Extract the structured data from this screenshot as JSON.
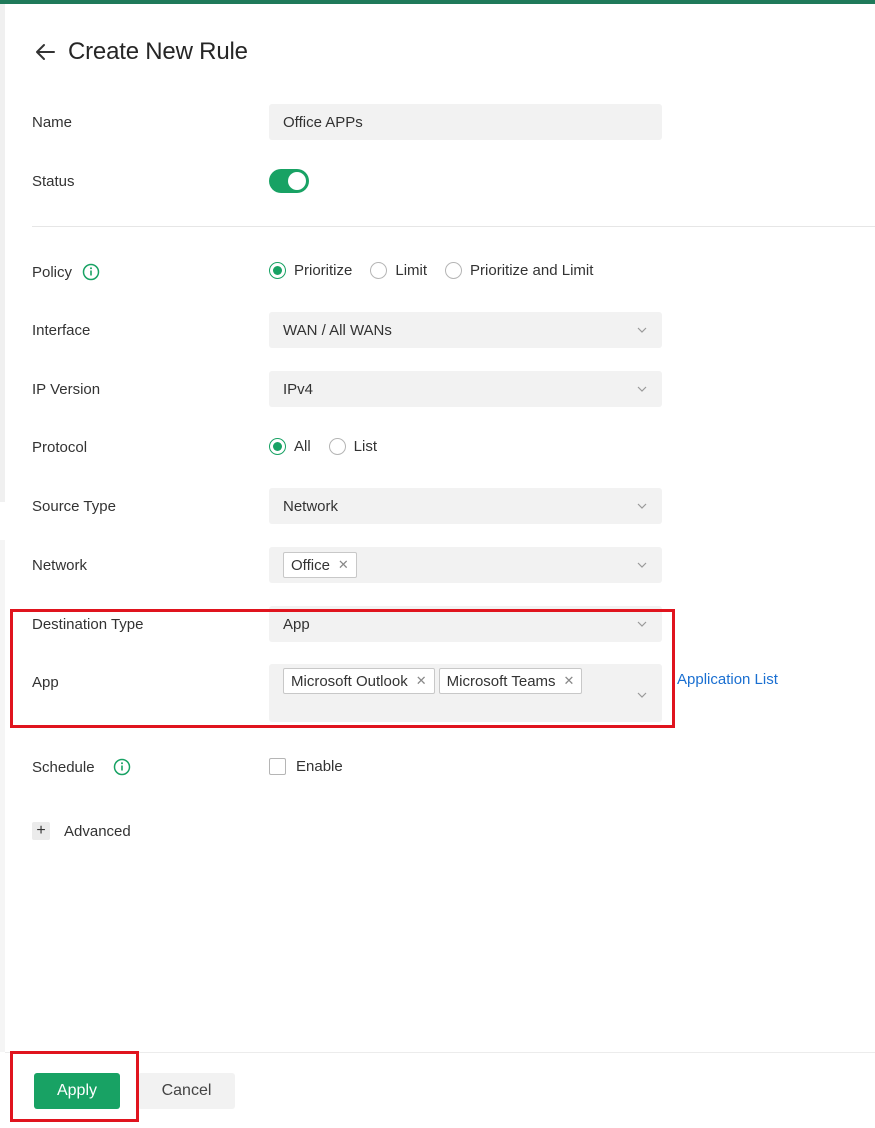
{
  "header": {
    "title": "Create New Rule",
    "back_icon": "arrow-left-icon"
  },
  "form": {
    "name": {
      "label": "Name",
      "value": "Office APPs"
    },
    "status": {
      "label": "Status",
      "enabled": true
    },
    "policy": {
      "label": "Policy",
      "options": [
        "Prioritize",
        "Limit",
        "Prioritize and Limit"
      ],
      "selected": "Prioritize"
    },
    "interface": {
      "label": "Interface",
      "value": "WAN / All WANs"
    },
    "ip_version": {
      "label": "IP Version",
      "value": "IPv4"
    },
    "protocol": {
      "label": "Protocol",
      "options": [
        "All",
        "List"
      ],
      "selected": "All"
    },
    "source_type": {
      "label": "Source Type",
      "value": "Network"
    },
    "network": {
      "label": "Network",
      "tags": [
        "Office"
      ]
    },
    "destination_type": {
      "label": "Destination Type",
      "value": "App"
    },
    "app": {
      "label": "App",
      "tags": [
        "Microsoft Outlook",
        "Microsoft Teams"
      ],
      "link": "Application List"
    },
    "schedule": {
      "label": "Schedule",
      "checkbox_label": "Enable",
      "checked": false
    },
    "advanced": {
      "label": "Advanced"
    }
  },
  "footer": {
    "apply_label": "Apply",
    "cancel_label": "Cancel"
  },
  "colors": {
    "accent": "#18a264",
    "link": "#1a6fd1",
    "highlight": "#e0141e",
    "top_bar": "#1f7a5a"
  }
}
